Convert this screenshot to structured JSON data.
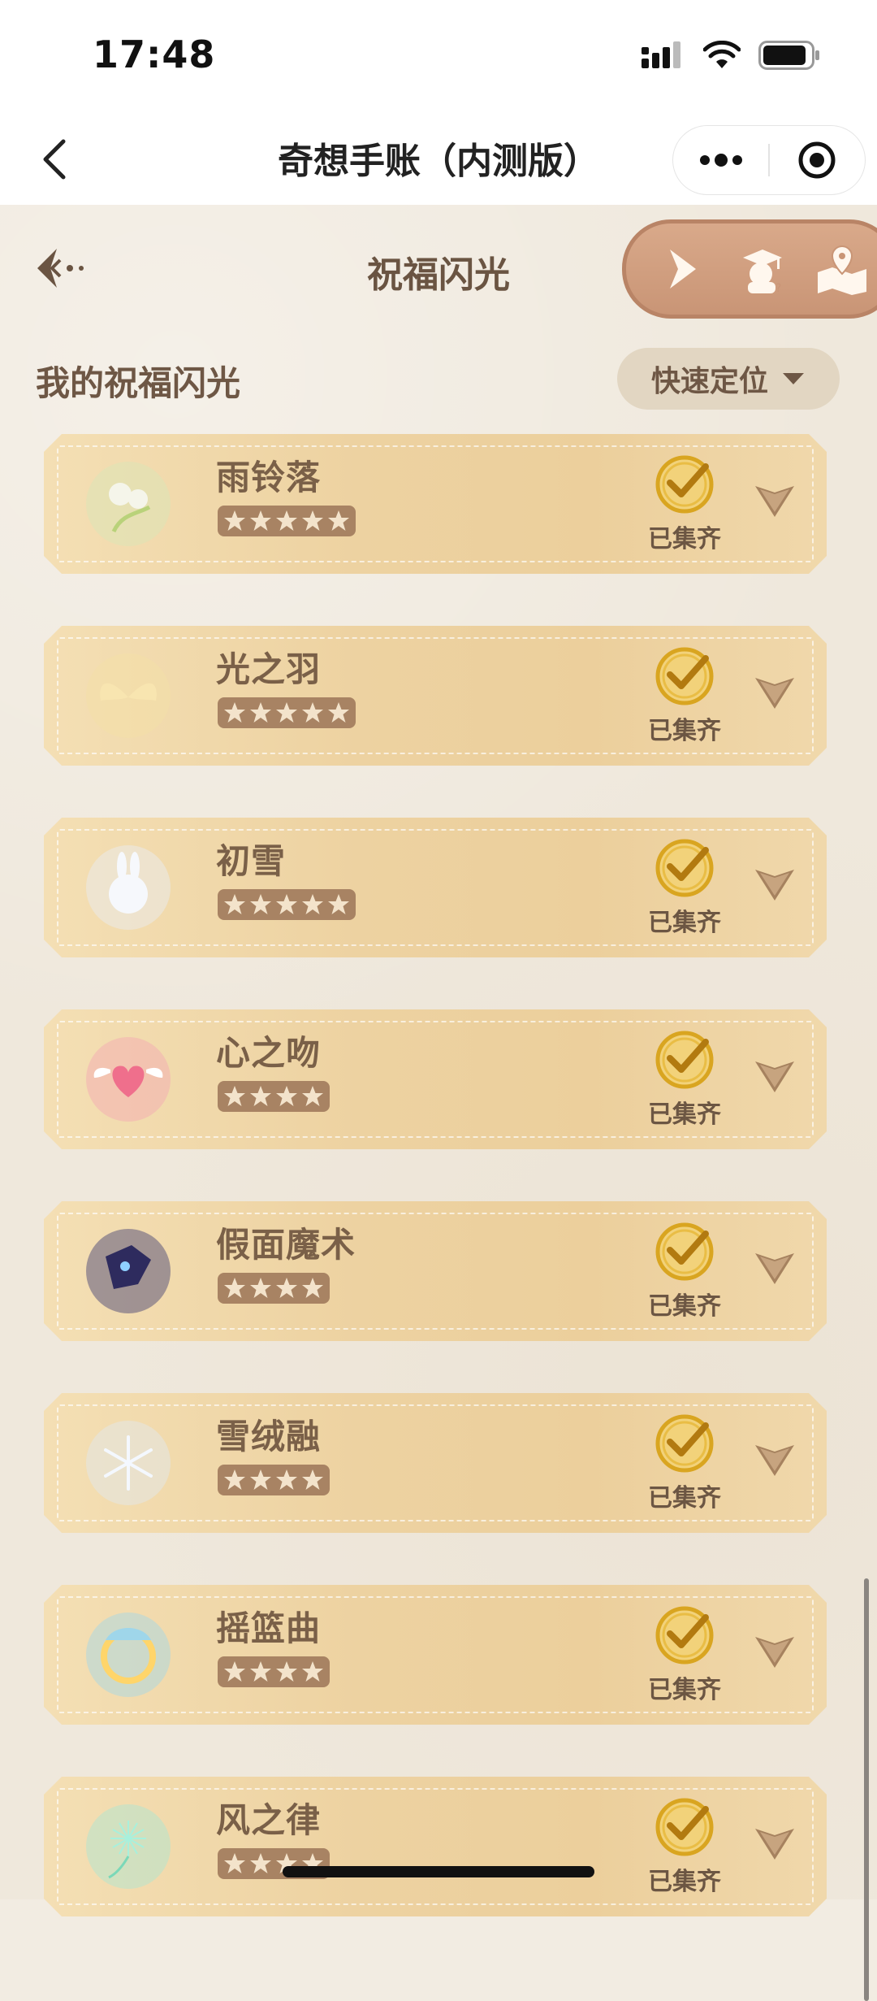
{
  "status_bar": {
    "time": "17:48"
  },
  "nav": {
    "title": "奇想手账（内测版）",
    "more_icon": "more-dots-icon",
    "close_icon": "target-close-icon"
  },
  "page": {
    "title": "祝福闪光",
    "section_title": "我的祝福闪光",
    "locate_label": "快速定位",
    "tools": [
      "play-arrow-icon",
      "scholar-mascot-icon",
      "map-pin-icon"
    ]
  },
  "items": [
    {
      "name": "雨铃落",
      "stars": 5,
      "status": "已集齐",
      "icon": "bell-flower-icon",
      "tint": "#d8e6b8"
    },
    {
      "name": "光之羽",
      "stars": 5,
      "status": "已集齐",
      "icon": "golden-wings-icon",
      "tint": "#f3e0a6"
    },
    {
      "name": "初雪",
      "stars": 5,
      "status": "已集齐",
      "icon": "snow-bunny-icon",
      "tint": "#e8eef6"
    },
    {
      "name": "心之吻",
      "stars": 4,
      "status": "已集齐",
      "icon": "winged-heart-icon",
      "tint": "#f3a6b4"
    },
    {
      "name": "假面魔术",
      "stars": 4,
      "status": "已集齐",
      "icon": "mask-magic-icon",
      "tint": "#3c3a72"
    },
    {
      "name": "雪绒融",
      "stars": 4,
      "status": "已集齐",
      "icon": "snowflake-icon",
      "tint": "#dfe8f2"
    },
    {
      "name": "摇篮曲",
      "stars": 4,
      "status": "已集齐",
      "icon": "lullaby-moon-icon",
      "tint": "#9fd6ea"
    },
    {
      "name": "风之律",
      "stars": 4,
      "status": "已集齐",
      "icon": "dandelion-icon",
      "tint": "#a8e6d4"
    }
  ],
  "colors": {
    "card": "#eccf9c",
    "check": "#d9a520",
    "text": "#7a6048",
    "background": "#efe8dc"
  }
}
